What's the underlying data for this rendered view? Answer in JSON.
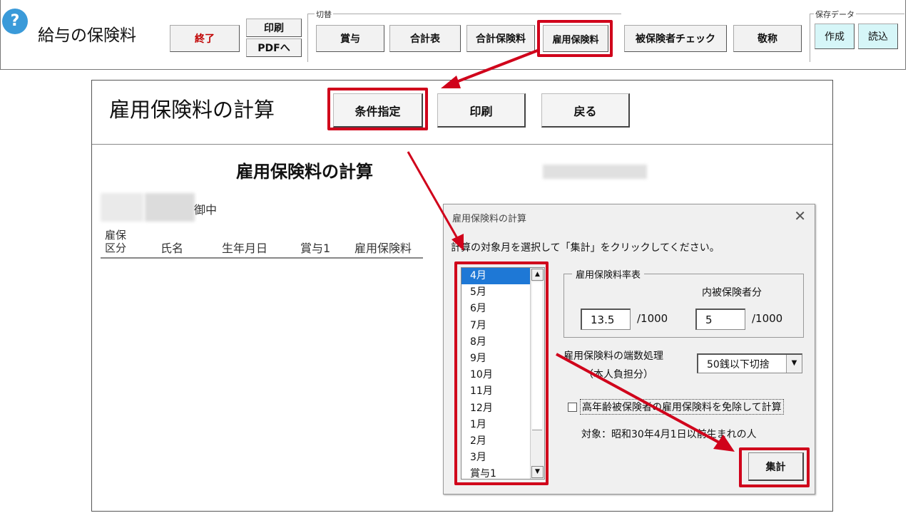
{
  "toolbar": {
    "help_glyph": "?",
    "app_title": "給与の保険料",
    "quit_label": "終了",
    "print_label": "印刷",
    "pdf_label": "PDFへ",
    "switch_group_label": "切替",
    "switch_buttons": [
      "賞与",
      "合計表",
      "合計保険料",
      "雇用保険料",
      "被保険者チェック",
      "敬称"
    ],
    "save_group_label": "保存データ",
    "create_label": "作成",
    "load_label": "読込"
  },
  "main": {
    "title": "雇用保険料の計算",
    "condition_button": "条件指定",
    "print_button": "印刷",
    "back_button": "戻る",
    "report_title": "雇用保険料の計算",
    "addressee_suffix": "御中",
    "columns": [
      "雇保\n区分",
      "氏名",
      "生年月日",
      "賞与1",
      "雇用保険料"
    ]
  },
  "dialog": {
    "title": "雇用保険料の計算",
    "close_glyph": "✕",
    "instruction": "計算の対象月を選択して「集計」をクリックしてください。",
    "months": [
      "4月",
      "5月",
      "6月",
      "7月",
      "8月",
      "9月",
      "10月",
      "11月",
      "12月",
      "1月",
      "2月",
      "3月",
      "賞与1"
    ],
    "selected_month": "4月",
    "rate_table_label": "雇用保険料率表",
    "insured_share_label": "内被保険者分",
    "rate_total": "13.5",
    "rate_total_unit": "/1000",
    "rate_insured": "5",
    "rate_insured_unit": "/1000",
    "rounding_label": "雇用保険料の端数処理",
    "rounding_sub": "（本人負担分）",
    "rounding_value": "50銭以下切捨",
    "elderly_exempt_label": "高年齢被保険者の雇用保険料を免除して計算",
    "elderly_exempt_checked": false,
    "target_note": "対象：昭和30年4月1日以前生まれの人",
    "aggregate_button": "集計"
  },
  "colors": {
    "highlight": "#d0021b",
    "help_icon": "#3a9ad9",
    "quit_text": "#c00000",
    "selection": "#1e78d6",
    "save_buttons": "#d6f6f8"
  }
}
